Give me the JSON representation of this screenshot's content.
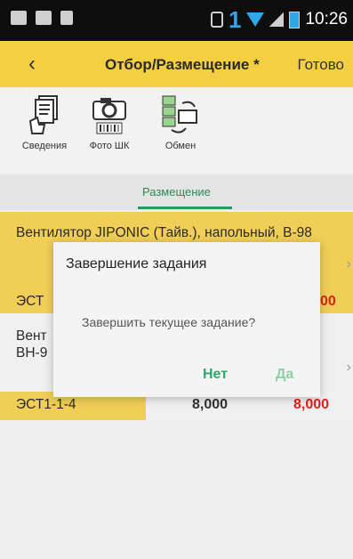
{
  "status_bar": {
    "notification_number": "1",
    "time": "10:26"
  },
  "action_bar": {
    "back_icon": "‹",
    "title": "Отбор/Размещение *",
    "done_label": "Готово"
  },
  "toolbar": {
    "items": [
      {
        "label": "Сведения",
        "icon": "document-hand-icon"
      },
      {
        "label": "Фото ШК",
        "icon": "camera-barcode-icon"
      },
      {
        "label": "Обмен",
        "icon": "exchange-icon"
      }
    ]
  },
  "tabs": {
    "active": "Размещение"
  },
  "list": {
    "items": [
      {
        "title": "Вентилятор JIPONIC (Тайв.), напольный, B-98",
        "code": "ЭСТ",
        "qty_visible": "00"
      },
      {
        "title": "Вент ВН-9",
        "code": "ЭСТ1-1-4",
        "qty": "8,000",
        "qty_red": "8,000"
      }
    ]
  },
  "dialog": {
    "title": "Завершение задания",
    "message": "Завершить текущее задание?",
    "no_label": "Нет",
    "yes_label": "Да"
  },
  "colors": {
    "accent_yellow": "#f4cf41",
    "tab_green": "#2c9b5b",
    "dialog_button_green": "#2fa76a",
    "qty_red": "#e02020"
  }
}
